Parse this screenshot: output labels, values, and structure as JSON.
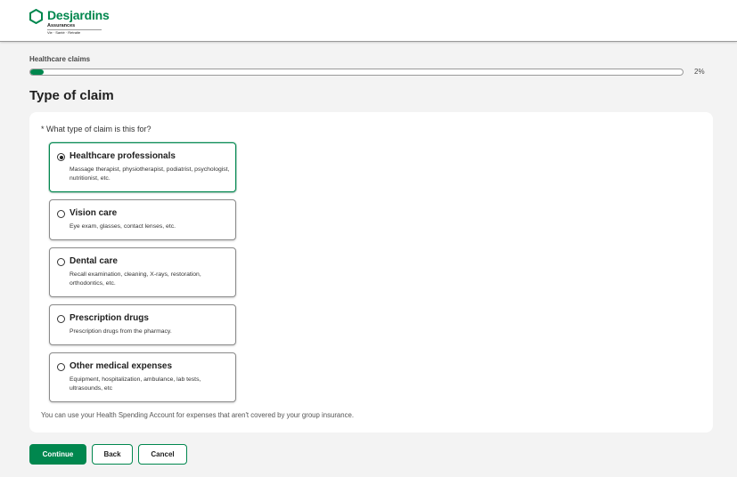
{
  "header": {
    "brand_name": "Desjardins",
    "brand_sub": "Assurances",
    "brand_tagline": "Vie · Santé · Retraite",
    "brand_color": "#00874e"
  },
  "progress": {
    "label": "Healthcare claims",
    "percent_text": "2%",
    "percent_value": 2
  },
  "page": {
    "title": "Type of claim"
  },
  "form": {
    "question": "* What type of claim is this for?",
    "selected_index": 0,
    "options": [
      {
        "title": "Healthcare professionals",
        "desc": "Massage therapist, physiotherapist, podiatrist, psychologist, nutritionist, etc."
      },
      {
        "title": "Vision care",
        "desc": "Eye exam, glasses, contact lenses, etc."
      },
      {
        "title": "Dental care",
        "desc": "Recall examination, cleaning, X-rays, restoration, orthodontics, etc."
      },
      {
        "title": "Prescription drugs",
        "desc": "Prescription drugs from the pharmacy."
      },
      {
        "title": "Other medical expenses",
        "desc": "Equipment, hospitalization, ambulance, lab tests, ultrasounds, etc"
      }
    ],
    "footnote": "You can use your Health Spending Account for expenses that aren't covered by your group insurance."
  },
  "actions": {
    "continue_label": "Continue",
    "back_label": "Back",
    "cancel_label": "Cancel"
  }
}
